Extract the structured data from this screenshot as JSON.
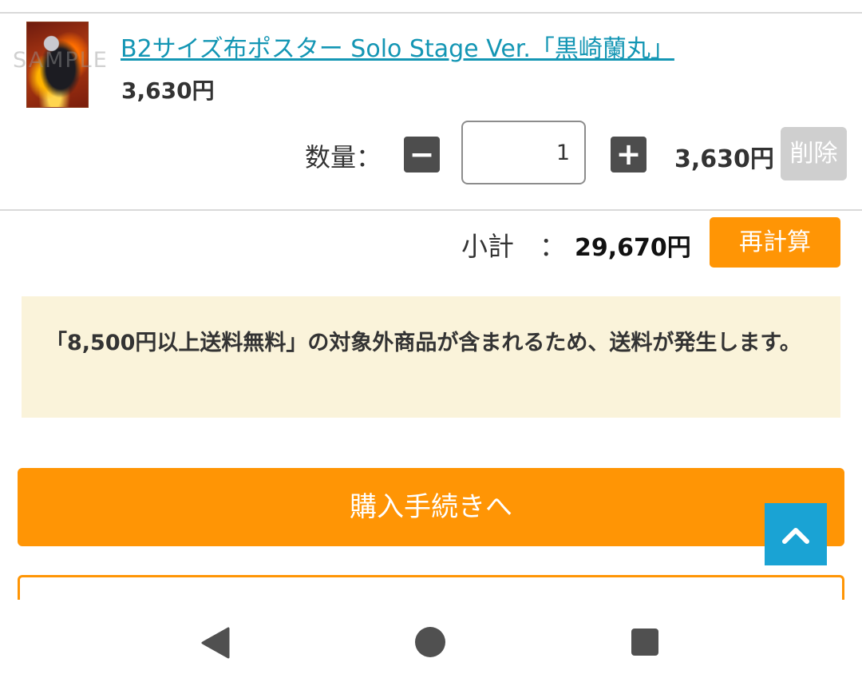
{
  "product": {
    "thumbnail_watermark": "SAMPLE",
    "name": "B2サイズ布ポスター Solo Stage Ver.「黒崎蘭丸」",
    "price": "3,630円"
  },
  "quantity": {
    "label": "数量：",
    "minus_icon": "minus-icon",
    "plus_icon": "plus-icon",
    "value": "1",
    "line_total": "3,630円",
    "delete_label": "削除"
  },
  "subtotal": {
    "label": "小計",
    "colon": "：",
    "value": "29,670円",
    "recalc_label": "再計算"
  },
  "notice": {
    "text": "「8,500円以上送料無料」の対象外商品が含まれるため、送料が発生します。"
  },
  "checkout": {
    "label": "購入手続きへ"
  },
  "scroll_top": {
    "icon": "chevron-up-icon"
  },
  "android_nav": {
    "back_icon": "back-triangle-icon",
    "home_icon": "home-circle-icon",
    "recents_icon": "recents-square-icon"
  },
  "colors": {
    "accent_orange": "#ff9505",
    "link_blue": "#1496b4",
    "scroll_blue": "#1aa3d4",
    "notice_bg": "#faf3da",
    "delete_gray": "#cfcfcf"
  }
}
